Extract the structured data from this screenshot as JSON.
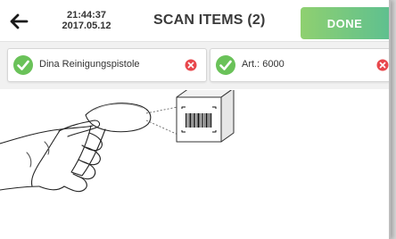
{
  "header": {
    "back_icon": "back-arrow-icon",
    "time": "21:44:37",
    "date": "2017.05.12",
    "title": "SCAN ITEMS (2)",
    "done_label": "DONE"
  },
  "scanned_items": [
    {
      "label": "Dina Reinigungspistole",
      "status_icon": "check-circle-icon",
      "remove_icon": "remove-circle-icon"
    },
    {
      "label": "Art.: 6000",
      "status_icon": "check-circle-icon",
      "remove_icon": "remove-circle-icon"
    }
  ],
  "colors": {
    "accent_green": "#6ac259",
    "done_gradient_start": "#8fd070",
    "done_gradient_end": "#5fc08f",
    "remove_red": "#e8474c"
  }
}
